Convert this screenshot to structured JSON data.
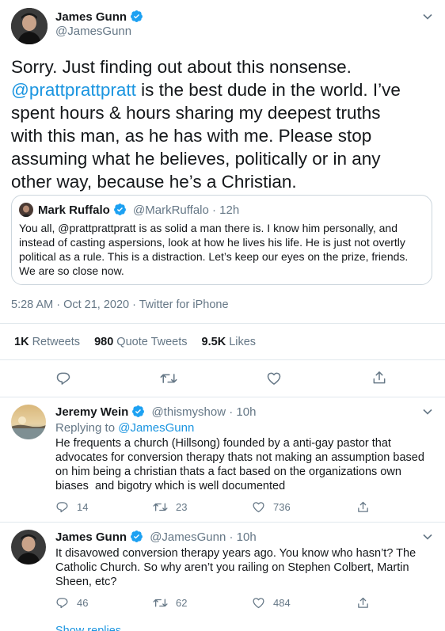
{
  "main_tweet": {
    "author_name": "James Gunn",
    "author_handle": "@JamesGunn",
    "text_line1": "Sorry. Just finding out about this nonsense.",
    "mention": "@prattprattpratt",
    "text_rest": " is the best dude in the world. I’ve spent hours & hours sharing my deepest truths with this man, as he has with me. Please stop assuming what he believes, politically or in any other way, because he’s a Christian.",
    "quoted": {
      "author_name": "Mark Ruffalo",
      "author_handle": "@MarkRuffalo",
      "time": "· 12h",
      "text": "You all, @prattprattpratt is as solid a man there is. I know him personally, and instead of casting aspersions, look at how he lives his life. He is just not overtly political as a rule. This is a distraction. Let’s keep our eyes on the prize, friends. We are so close now."
    },
    "timestamp": "5:28 AM · Oct 21, 2020 · Twitter for iPhone",
    "stats": {
      "retweets_count": "1K",
      "retweets_label": "Retweets",
      "quotes_count": "980",
      "quotes_label": "Quote Tweets",
      "likes_count": "9.5K",
      "likes_label": "Likes"
    }
  },
  "replies": [
    {
      "author_name": "Jeremy Wein",
      "author_handle": "@thismyshow",
      "time": "· 10h",
      "replying_prefix": "Replying to",
      "replying_to": "@JamesGunn",
      "text": "He frequents a church (Hillsong) founded by a anti-gay pastor that advocates for conversion therapy thats not making an assumption based on him being a christian thats a fact based on the organizations own biases  and bigotry which is well documented",
      "reply_count": "14",
      "retweet_count": "23",
      "like_count": "736"
    },
    {
      "author_name": "James Gunn",
      "author_handle": "@JamesGunn",
      "time": "· 10h",
      "text": "It disavowed conversion therapy years ago. You know who hasn’t? The Catholic Church. So why aren’t you railing on Stephen Colbert, Martin Sheen, etc?",
      "reply_count": "46",
      "retweet_count": "62",
      "like_count": "484"
    }
  ],
  "show_replies": "Show replies",
  "colors": {
    "accent": "#1b95e0",
    "secondary": "#657786",
    "border": "#e1e8ed"
  },
  "icons": [
    "verified-badge-icon",
    "chevron-down-icon",
    "reply-icon",
    "retweet-icon",
    "like-icon",
    "share-icon"
  ]
}
